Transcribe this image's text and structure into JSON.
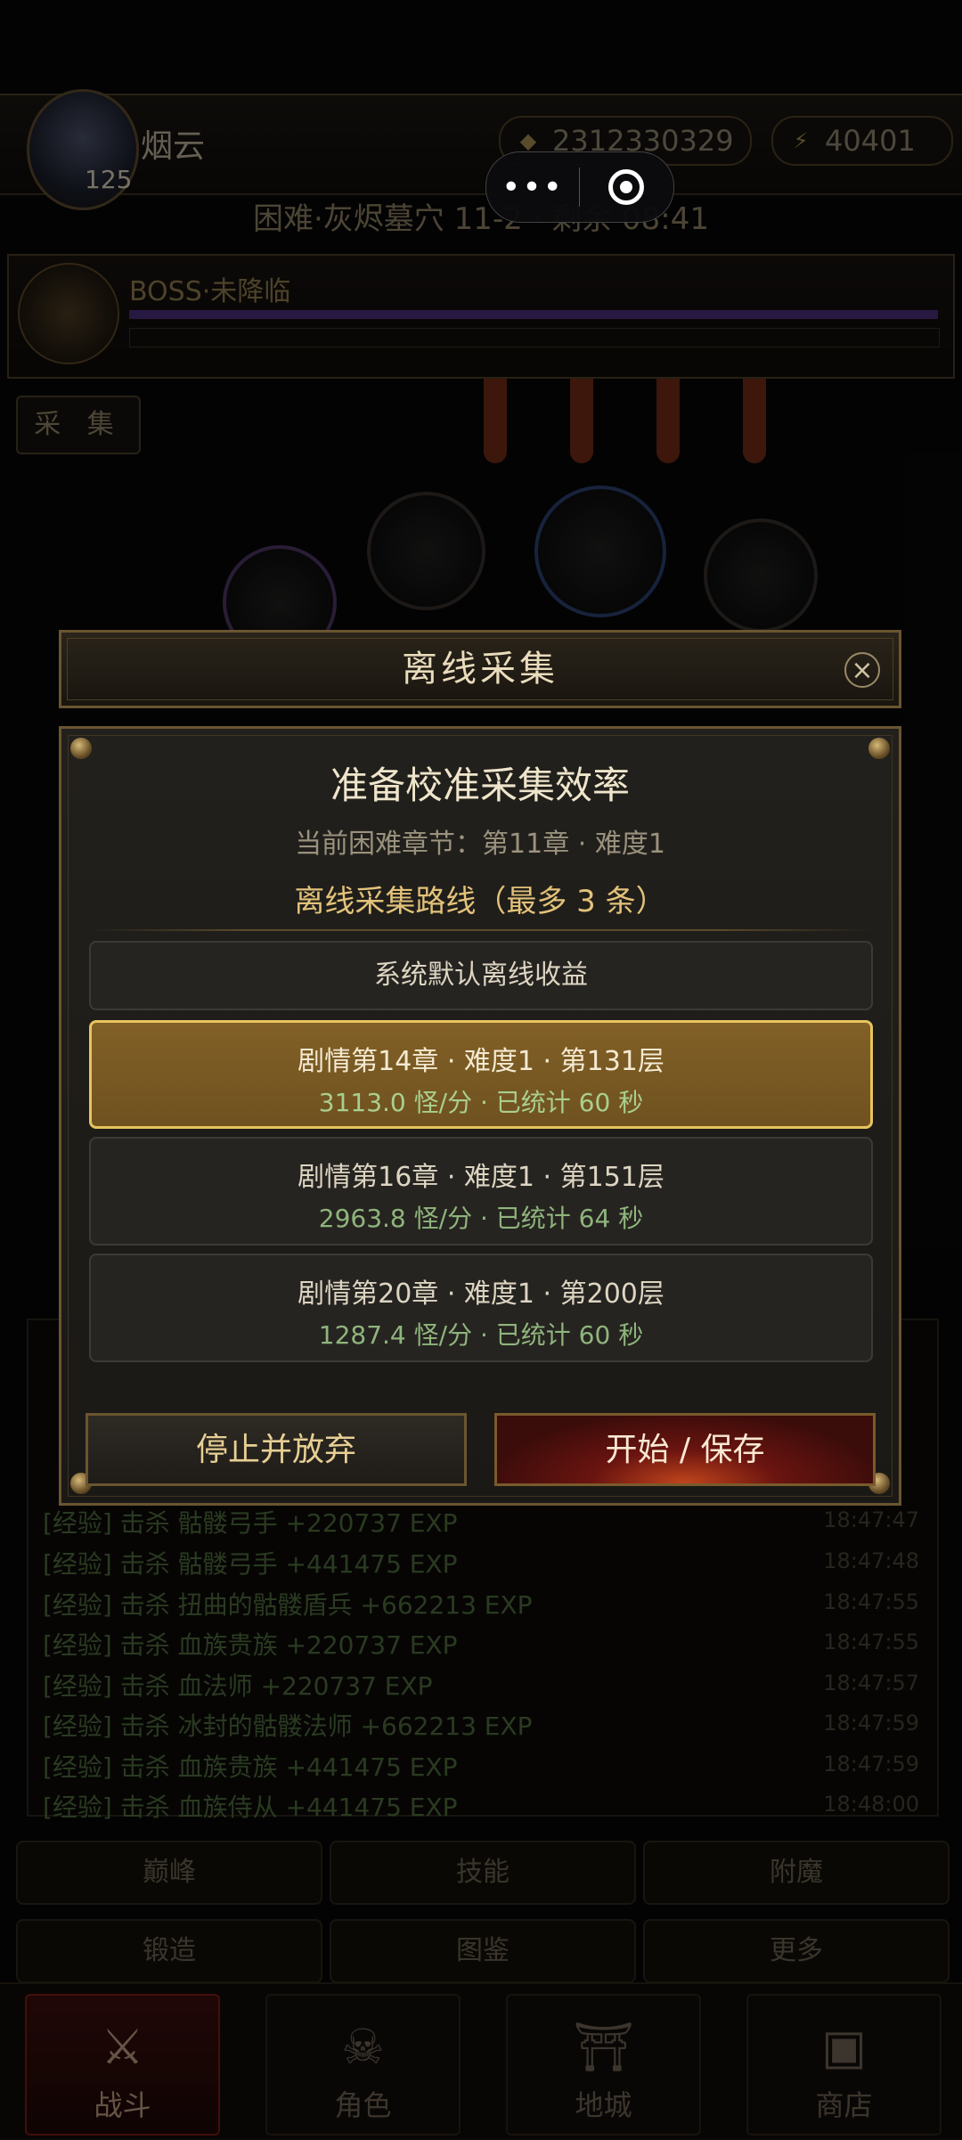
{
  "player": {
    "name": "烟云",
    "level": "125",
    "gold": "2312330329",
    "energy": "40401"
  },
  "stage_info": "困难·灰烬墓穴 11-2 · 剩余 08:41",
  "boss": {
    "label": "BOSS·未降临"
  },
  "collect_button": "采 集",
  "battle_log": [
    {
      "text": "[经验] 击杀 骷髅弓手 +220737 EXP",
      "time": "18:47:47"
    },
    {
      "text": "[经验] 击杀 骷髅弓手 +441475 EXP",
      "time": "18:47:48"
    },
    {
      "text": "[经验] 击杀 扭曲的骷髅盾兵 +662213 EXP",
      "time": "18:47:55"
    },
    {
      "text": "[经验] 击杀 血族贵族 +220737 EXP",
      "time": "18:47:55"
    },
    {
      "text": "[经验] 击杀 血法师 +220737 EXP",
      "time": "18:47:57"
    },
    {
      "text": "[经验] 击杀 冰封的骷髅法师 +662213 EXP",
      "time": "18:47:59"
    },
    {
      "text": "[经验] 击杀 血族贵族 +441475 EXP",
      "time": "18:47:59"
    },
    {
      "text": "[经验] 击杀 血族侍从 +441475 EXP",
      "time": "18:48:00"
    }
  ],
  "grid_buttons": [
    "巅峰",
    "技能",
    "附魔",
    "锻造",
    "图鉴",
    "更多"
  ],
  "nav": [
    {
      "label": "战斗",
      "icon": "crossed-swords-icon"
    },
    {
      "label": "角色",
      "icon": "character-icon"
    },
    {
      "label": "地城",
      "icon": "dungeon-gate-icon"
    },
    {
      "label": "商店",
      "icon": "chest-icon"
    }
  ],
  "dialog": {
    "title": "离线采集",
    "heading": "准备校准采集效率",
    "chapter_info": "当前困难章节：第11章 · 难度1",
    "routes_title": "离线采集路线（最多 3 条）",
    "default_option": "系统默认离线收益",
    "routes": [
      {
        "line1": "剧情第14章 · 难度1 · 第131层",
        "line2": "3113.0 怪/分 · 已统计 60 秒",
        "selected": true
      },
      {
        "line1": "剧情第16章 · 难度1 · 第151层",
        "line2": "2963.8 怪/分 · 已统计 64 秒",
        "selected": false
      },
      {
        "line1": "剧情第20章 · 难度1 · 第200层",
        "line2": "1287.4 怪/分 · 已统计 60 秒",
        "selected": false
      }
    ],
    "stop_button": "停止并放弃",
    "start_button": "开始 / 保存"
  },
  "colors": {
    "accent_gold": "#e7c45e",
    "exp_green": "#8fb57c",
    "danger_red": "#6a1410"
  }
}
